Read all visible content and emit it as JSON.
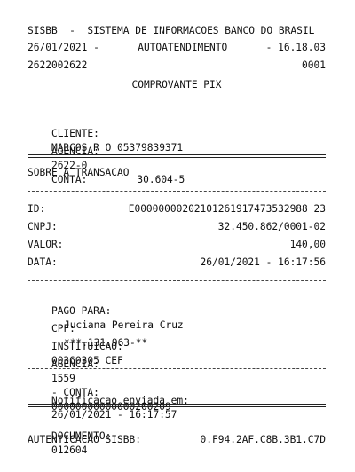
{
  "header": {
    "title": "SISBB  -  SISTEMA DE INFORMACOES BANCO DO BRASIL",
    "date": "26/01/2021 -",
    "service": "AUTOATENDIMENTO",
    "time": "- 16.18.03",
    "terminal": "2622002622",
    "sequence": "0001",
    "doc_type": "COMPROVANTE PIX"
  },
  "client": {
    "label": "CLIENTE:",
    "value": "MARCOS R O 05379839371",
    "agency_label": "AGENCIA:",
    "agency": "2622-0",
    "account_label": "CONTA:",
    "account": "30.604-5"
  },
  "section": {
    "title": "SOBRE A TRANSACAO"
  },
  "transaction": {
    "id_label": "ID:",
    "id": "E00000000202101261917473532988 23",
    "cnpj_label": "CNPJ:",
    "cnpj": "32.450.862/0001-02",
    "value_label": "VALOR:",
    "value": "140,00",
    "date_label": "DATA:",
    "date": "26/01/2021 - 16:17:56"
  },
  "payee": {
    "paid_to_label": "PAGO PARA:",
    "paid_to": "Juciana Pereira Cruz",
    "cpf_label": "CPF:",
    "cpf": "***.131.963-**",
    "institution_label": "INSTITUICAO:",
    "institution": "00360305 CEF",
    "agency_label": "AGENCIA:",
    "agency": "1559",
    "account_label": "- CONTA:",
    "account": "00000000000000200209"
  },
  "notification": {
    "label": "Notificacao enviada em:",
    "datetime": "26/01/2021 - 16:17:57"
  },
  "footer": {
    "document_label": "DOCUMENTO:",
    "document": "012604",
    "auth_label": "AUTENTICACAO SISBB:",
    "auth": "0.F94.2AF.C8B.3B1.C7D"
  }
}
